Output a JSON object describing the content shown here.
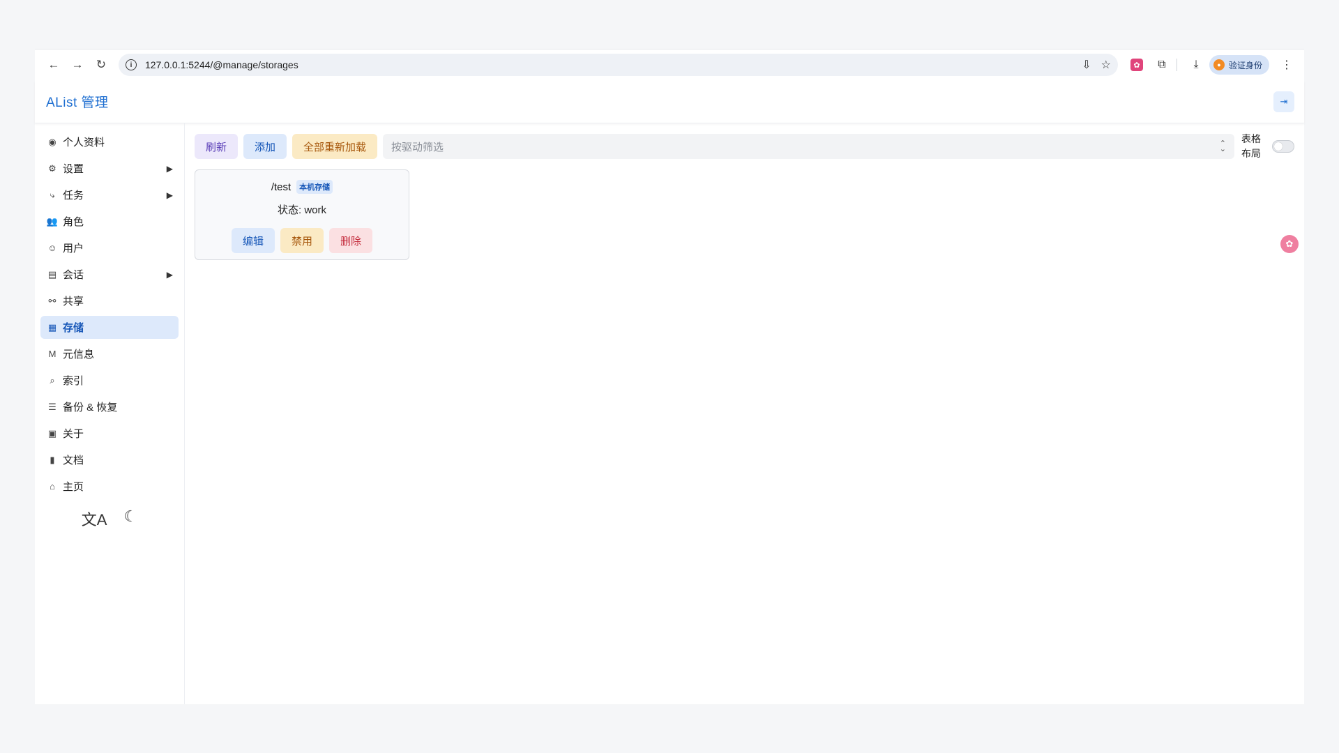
{
  "browser": {
    "url": "127.0.0.1:5244/@manage/storages",
    "profile_label": "验证身份"
  },
  "app": {
    "title": "AList 管理"
  },
  "sidebar": {
    "items": [
      {
        "label": "个人资料",
        "icon": "profile-icon",
        "glyph": "◉",
        "arrow": false,
        "active": false
      },
      {
        "label": "设置",
        "icon": "gear-icon",
        "glyph": "⚙",
        "arrow": true,
        "active": false
      },
      {
        "label": "任务",
        "icon": "flow-icon",
        "glyph": "⤷",
        "arrow": true,
        "active": false
      },
      {
        "label": "角色",
        "icon": "role-icon",
        "glyph": "👥",
        "arrow": false,
        "active": false
      },
      {
        "label": "用户",
        "icon": "user-circle-icon",
        "glyph": "☺",
        "arrow": false,
        "active": false
      },
      {
        "label": "会话",
        "icon": "message-icon",
        "glyph": "▤",
        "arrow": true,
        "active": false
      },
      {
        "label": "共享",
        "icon": "link-icon",
        "glyph": "⚯",
        "arrow": false,
        "active": false
      },
      {
        "label": "存储",
        "icon": "storage-icon",
        "glyph": "▦",
        "arrow": false,
        "active": true
      },
      {
        "label": "元信息",
        "icon": "meta-icon",
        "glyph": "M",
        "arrow": false,
        "active": false
      },
      {
        "label": "索引",
        "icon": "search-icon",
        "glyph": "⌕",
        "arrow": false,
        "active": false
      },
      {
        "label": "备份 & 恢复",
        "icon": "database-icon",
        "glyph": "☰",
        "arrow": false,
        "active": false
      },
      {
        "label": "关于",
        "icon": "about-icon",
        "glyph": "▣",
        "arrow": false,
        "active": false
      },
      {
        "label": "文档",
        "icon": "book-icon",
        "glyph": "▮",
        "arrow": false,
        "active": false
      },
      {
        "label": "主页",
        "icon": "home-icon",
        "glyph": "⌂",
        "arrow": false,
        "active": false
      }
    ]
  },
  "toolbar": {
    "refresh_label": "刷新",
    "add_label": "添加",
    "reload_all_label": "全部重新加载",
    "filter_placeholder": "按驱动筛选",
    "table_layout_label_1": "表格",
    "table_layout_label_2": "布局",
    "table_layout_on": false
  },
  "storages": [
    {
      "mount_path": "/test",
      "driver": "本机存储",
      "status": "状态: work",
      "edit_label": "编辑",
      "disable_label": "禁用",
      "delete_label": "删除"
    }
  ]
}
